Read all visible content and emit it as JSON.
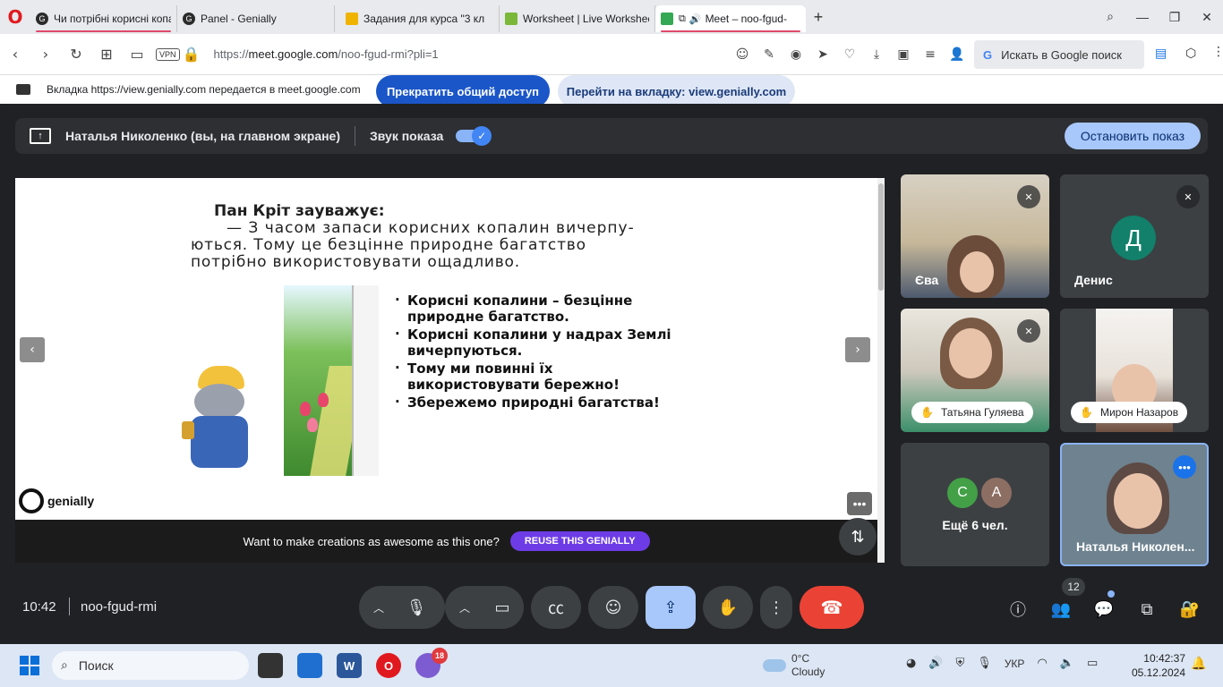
{
  "browser": {
    "tabs": [
      {
        "title": "Чи потрібні корисні копа",
        "fav_color": "#2b2b2b",
        "active": false,
        "underline": true
      },
      {
        "title": "Panel - Genially",
        "fav_color": "#2b2b2b",
        "active": false,
        "underline": false
      },
      {
        "title": "Задания для курса \"3 кл",
        "fav_color": "#f0b400",
        "active": false,
        "underline": false
      },
      {
        "title": "Worksheet | Live Workshee",
        "fav_color": "#7bb83a",
        "active": false,
        "underline": false
      },
      {
        "title": "Meet – noo-fgud-",
        "fav_color": "#34a853",
        "active": true,
        "underline": true
      }
    ],
    "new_tab": "+",
    "address": {
      "url_prefix": "https://",
      "url_host": "meet.google.com",
      "url_path": "/noo-fgud-rmi?pli=1",
      "vpn": "VPN"
    },
    "google_search": "Искать в Google поиск",
    "share_message": "Вкладка https://view.genially.com передается в meet.google.com",
    "stop_sharing": "Прекратить общий доступ",
    "go_to_tab": "Перейти на вкладку: view.genially.com"
  },
  "meet": {
    "presenter": "Наталья Николенко (вы, на главном экране)",
    "sound_label": "Звук показа",
    "stop_presenting": "Остановить показ",
    "slide": {
      "heading": "Пан Кріт зауважує:",
      "line2": "— З часом запаси корисних копалин вичерпу-",
      "line3": "ються. Тому це безцінне природне багатство",
      "line4": "потрібно використовувати ощадливо.",
      "bullets": [
        "Корисні копалини – безцінне природне багатство.",
        "Корисні копалини у надрах Землі вичерпуються.",
        "Тому ми повинні їх використовувати бережно!",
        "Збережемо природні багатства!"
      ],
      "logo_text": "genially",
      "reuse_text": "Want to make creations as awesome as this one?",
      "reuse_button": "REUSE THIS GENIALLY"
    },
    "participants": [
      {
        "name": "Єва"
      },
      {
        "name": "Денис",
        "initial": "Д"
      },
      {
        "name": "Татьяна Гуляева"
      },
      {
        "name": "Мирон Назаров"
      },
      {
        "more": "Ещё 6 чел.",
        "initials": [
          "С",
          "А"
        ]
      },
      {
        "name": "Наталья Николен..."
      }
    ],
    "clock": "10:42",
    "meeting_code": "noo-fgud-rmi",
    "people_count": "12"
  },
  "taskbar": {
    "search": "Поиск",
    "viber_badge": "18",
    "weather_temp": "0°C",
    "weather_desc": "Cloudy",
    "lang": "УКР",
    "time": "10:42:37",
    "date": "05.12.2024"
  },
  "colors": {
    "meet_bg": "#202124",
    "tile_bg": "#3c4043",
    "accent_blue": "#a8c7fa",
    "hangup_red": "#ea4335",
    "share_blue": "#1a56c8",
    "genially_purple": "#6e3ce6"
  }
}
